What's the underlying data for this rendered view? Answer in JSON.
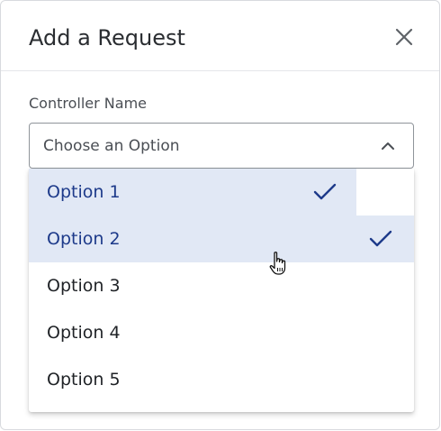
{
  "dialog": {
    "title": "Add a Request",
    "close_icon": "close-icon"
  },
  "field": {
    "label": "Controller Name",
    "placeholder": "Choose an Option",
    "toggle_icon": "chevron-up-icon"
  },
  "options": [
    {
      "label": "Option 1",
      "selected": true
    },
    {
      "label": "Option 2",
      "selected": true
    },
    {
      "label": "Option 3",
      "selected": false
    },
    {
      "label": "Option 4",
      "selected": false
    },
    {
      "label": "Option 5",
      "selected": false
    }
  ],
  "colors": {
    "selected_bg": "#e1e8f5",
    "selected_text": "#1d3a8a",
    "check": "#1d3a8a"
  },
  "pointer_icon": "hand-pointer-icon"
}
